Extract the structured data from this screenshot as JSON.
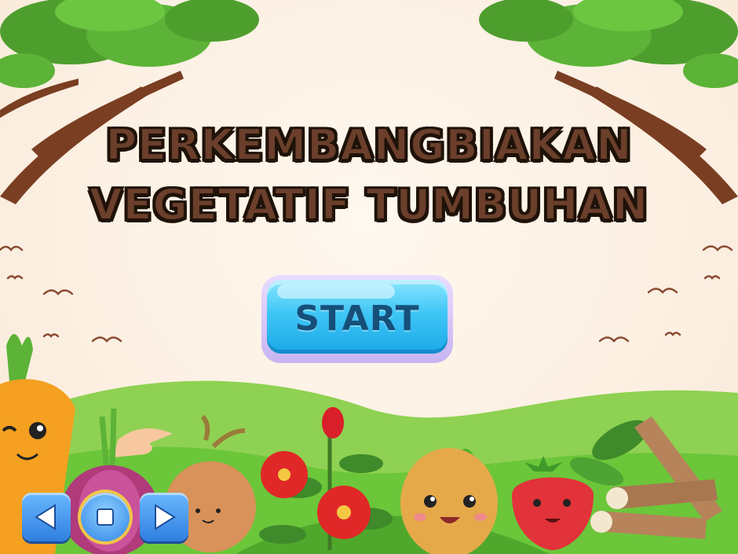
{
  "title": {
    "line1": "PERKEMBANGBIAKAN",
    "line2": "VEGETATIF TUMBUHAN"
  },
  "start_button": {
    "label": "START"
  },
  "nav": {
    "prev_icon": "triangle-left-icon",
    "stop_icon": "square-stop-icon",
    "next_icon": "triangle-right-icon"
  },
  "colors": {
    "title": "#6b3f2b",
    "title_outline": "#1f1208",
    "start_button": "#3fc6f5",
    "nav_button": "#2f7fe0",
    "grass": "#6cc63a",
    "background": "#fbeee0"
  }
}
